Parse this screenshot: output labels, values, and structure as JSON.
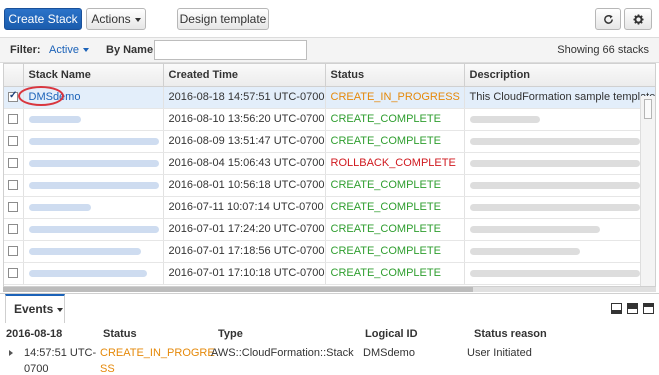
{
  "toolbar": {
    "create_stack": "Create Stack",
    "actions": "Actions",
    "design_template": "Design template",
    "refresh_icon": "refresh-icon",
    "settings_icon": "gear-icon"
  },
  "filter": {
    "label": "Filter:",
    "value": "Active",
    "by_name_label": "By Name:",
    "by_name_value": "",
    "count": "Showing 66 stacks"
  },
  "table": {
    "columns": [
      "Stack Name",
      "Created Time",
      "Status",
      "Description"
    ],
    "rows": [
      {
        "checked": true,
        "name": "DMSdemo",
        "created": "2016-08-18 14:57:51 UTC-0700",
        "status": "CREATE_IN_PROGRESS",
        "description": "This CloudFormation sample template C"
      },
      {
        "checked": false,
        "name": "",
        "created": "2016-08-10 13:56:20 UTC-0700",
        "status": "CREATE_COMPLETE",
        "description": ""
      },
      {
        "checked": false,
        "name": "",
        "created": "2016-08-09 13:51:47 UTC-0700",
        "status": "CREATE_COMPLETE",
        "description": ""
      },
      {
        "checked": false,
        "name": "",
        "created": "2016-08-04 15:06:43 UTC-0700",
        "status": "ROLLBACK_COMPLETE",
        "description": ""
      },
      {
        "checked": false,
        "name": "",
        "created": "2016-08-01 10:56:18 UTC-0700",
        "status": "CREATE_COMPLETE",
        "description": ""
      },
      {
        "checked": false,
        "name": "",
        "created": "2016-07-11 10:07:14 UTC-0700",
        "status": "CREATE_COMPLETE",
        "description": ""
      },
      {
        "checked": false,
        "name": "",
        "created": "2016-07-01 17:24:20 UTC-0700",
        "status": "CREATE_COMPLETE",
        "description": ""
      },
      {
        "checked": false,
        "name": "",
        "created": "2016-07-01 17:18:56 UTC-0700",
        "status": "CREATE_COMPLETE",
        "description": ""
      },
      {
        "checked": false,
        "name": "",
        "created": "2016-07-01 17:10:18 UTC-0700",
        "status": "CREATE_COMPLETE",
        "description": ""
      }
    ]
  },
  "events": {
    "tab_label": "Events",
    "date": "2016-08-18",
    "headers": {
      "status": "Status",
      "type": "Type",
      "logical_id": "Logical ID",
      "reason": "Status reason"
    },
    "row": {
      "time_line1": "14:57:51 UTC-",
      "time_line2": "0700",
      "status_line1": "CREATE_IN_PROGRE",
      "status_line2": "SS",
      "type": "AWS::CloudFormation::Stack",
      "logical_id": "DMSdemo",
      "reason": "User Initiated"
    }
  },
  "colors": {
    "primary": "#1b62b8",
    "in_progress": "#e5890a",
    "complete": "#2f9e2f",
    "rollback": "#d0191f",
    "selected_row": "#e3eefa"
  }
}
